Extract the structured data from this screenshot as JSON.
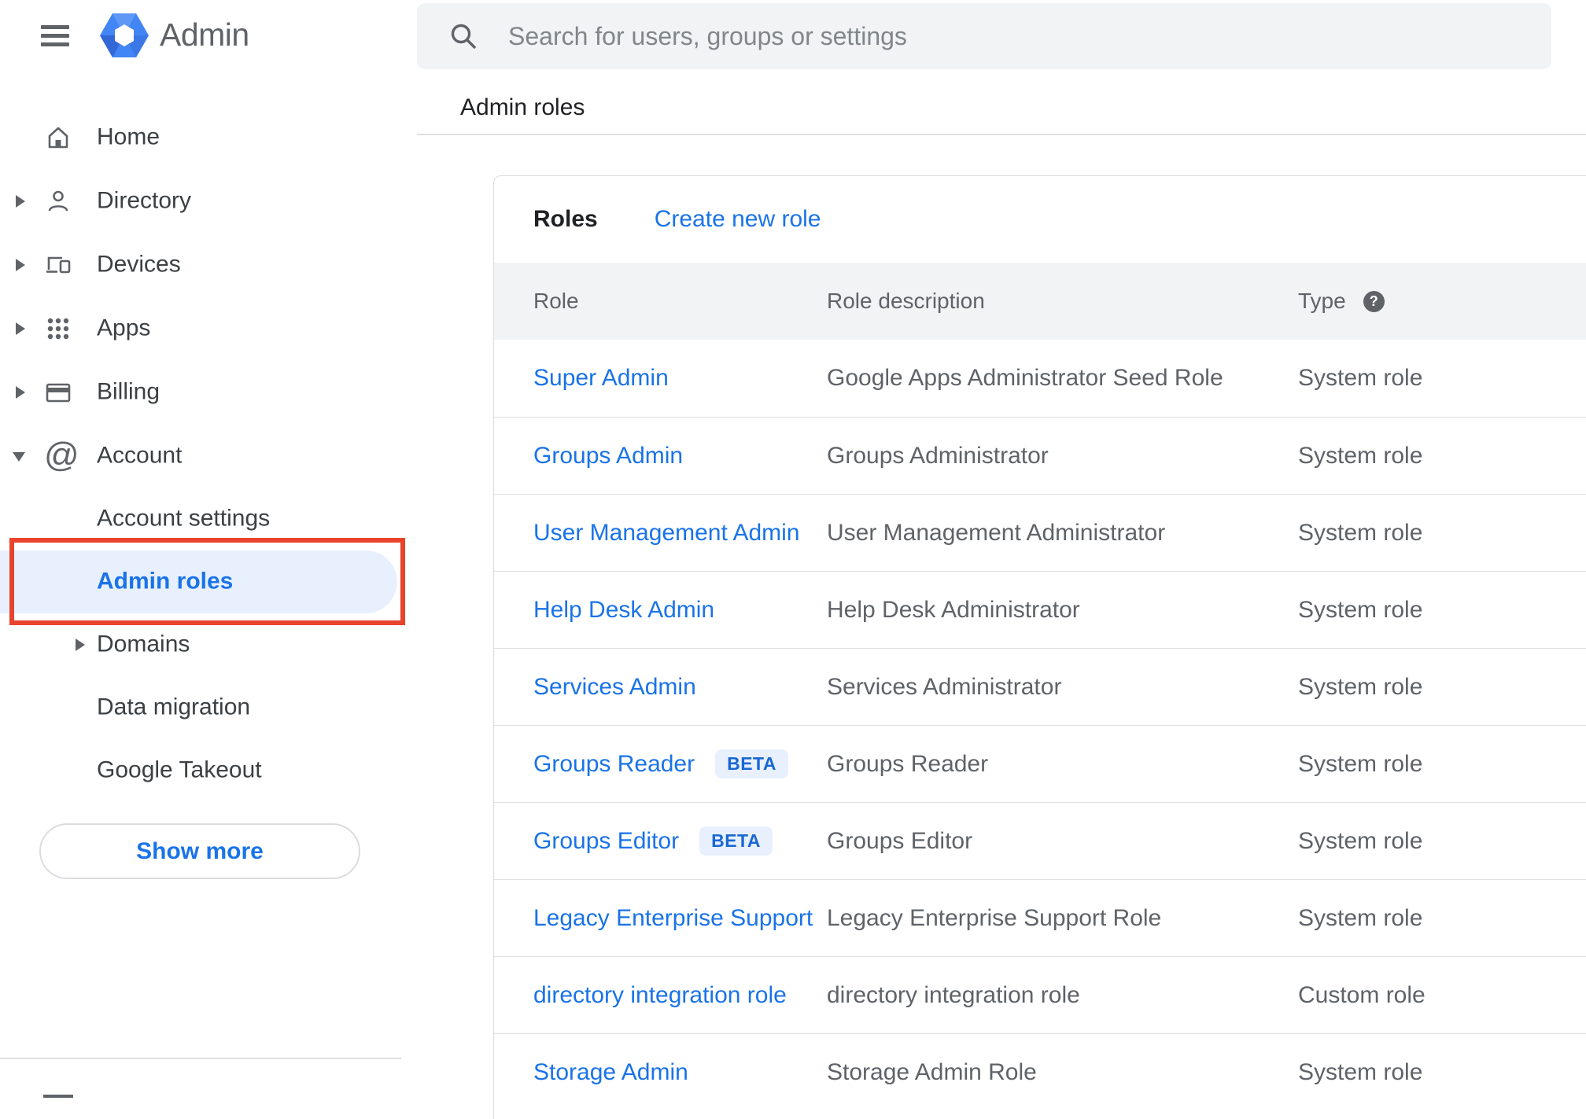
{
  "app": {
    "title": "Admin"
  },
  "search": {
    "placeholder": "Search for users, groups or settings"
  },
  "breadcrumb": "Admin roles",
  "sidebar": {
    "items": [
      {
        "label": "Home",
        "icon": "home",
        "expandable": false,
        "expanded": false
      },
      {
        "label": "Directory",
        "icon": "person",
        "expandable": true,
        "expanded": false
      },
      {
        "label": "Devices",
        "icon": "devices",
        "expandable": true,
        "expanded": false
      },
      {
        "label": "Apps",
        "icon": "apps",
        "expandable": true,
        "expanded": false
      },
      {
        "label": "Billing",
        "icon": "card",
        "expandable": true,
        "expanded": false
      },
      {
        "label": "Account",
        "icon": "at",
        "expandable": true,
        "expanded": true
      }
    ],
    "account_children": [
      {
        "label": "Account settings",
        "expandable": false,
        "selected": false,
        "annotated": false
      },
      {
        "label": "Admin roles",
        "expandable": false,
        "selected": true,
        "annotated": true
      },
      {
        "label": "Domains",
        "expandable": true,
        "selected": false,
        "annotated": false
      },
      {
        "label": "Data migration",
        "expandable": false,
        "selected": false,
        "annotated": false
      },
      {
        "label": "Google Takeout",
        "expandable": false,
        "selected": false,
        "annotated": false
      }
    ],
    "show_more_label": "Show more"
  },
  "main": {
    "card_title": "Roles",
    "create_link": "Create new role",
    "beta_label": "BETA",
    "table": {
      "columns": {
        "role": "Role",
        "description": "Role description",
        "type": "Type"
      },
      "rows": [
        {
          "role": "Super Admin",
          "beta": false,
          "description": "Google Apps Administrator Seed Role",
          "type": "System role"
        },
        {
          "role": "Groups Admin",
          "beta": false,
          "description": "Groups Administrator",
          "type": "System role"
        },
        {
          "role": "User Management Admin",
          "beta": false,
          "description": "User Management Administrator",
          "type": "System role"
        },
        {
          "role": "Help Desk Admin",
          "beta": false,
          "description": "Help Desk Administrator",
          "type": "System role"
        },
        {
          "role": "Services Admin",
          "beta": false,
          "description": "Services Administrator",
          "type": "System role"
        },
        {
          "role": "Groups Reader",
          "beta": true,
          "description": "Groups Reader",
          "type": "System role"
        },
        {
          "role": "Groups Editor",
          "beta": true,
          "description": "Groups Editor",
          "type": "System role"
        },
        {
          "role": "Legacy Enterprise Support",
          "beta": false,
          "description": "Legacy Enterprise Support Role",
          "type": "System role"
        },
        {
          "role": "directory integration role",
          "beta": false,
          "description": "directory integration role",
          "type": "Custom role"
        },
        {
          "role": "Storage Admin",
          "beta": false,
          "description": "Storage Admin Role",
          "type": "System role"
        }
      ]
    }
  },
  "colors": {
    "accent_blue": "#1a73e8",
    "selected_bg": "#e8f0fe",
    "badge_text": "#1967d2",
    "annotation_red": "#e8432c",
    "logo_blue": "#4285f4"
  }
}
